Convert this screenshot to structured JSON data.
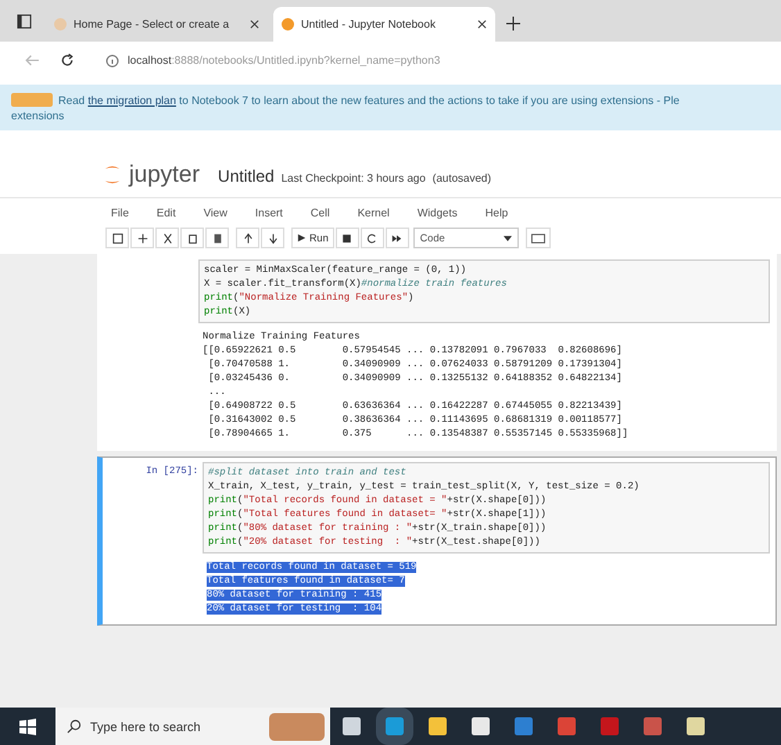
{
  "browser_tabs": [
    {
      "title": "Home Page - Select or create a",
      "selected": false
    },
    {
      "title": "Untitled - Jupyter Notebook",
      "selected": true
    }
  ],
  "address_bar": {
    "host": "localhost",
    "path": ":8888/notebooks/Untitled.ipynb?kernel_name=python3"
  },
  "banner": {
    "link": "the migration plan",
    "before": "Read",
    "after": "to Notebook 7 to learn about the new features and the actions to take if you are using extensions - Ple",
    "line_2": "extensions"
  },
  "notebook": {
    "logo": "jupyter",
    "name": "Untitled",
    "checkpoint": "Last Checkpoint: 3 hours ago",
    "autosave": "(autosaved)"
  },
  "menu": [
    "File",
    "Edit",
    "View",
    "Insert",
    "Cell",
    "Kernel",
    "Widgets",
    "Help"
  ],
  "toolbar": {
    "run": "Run",
    "cell_type": "Code"
  },
  "cells": [
    {
      "selected": false,
      "code": [
        [
          {
            "kind": "plain",
            "text": "scaler = MinMaxScaler(feature_range = (0, 1))"
          }
        ],
        [
          {
            "kind": "plain",
            "text": "X = scaler.fit_transform(X)"
          },
          {
            "kind": "comment",
            "text": "#normalize train features"
          }
        ],
        [
          {
            "kind": "builtin",
            "text": "print"
          },
          {
            "kind": "plain",
            "text": "("
          },
          {
            "kind": "string",
            "text": "\"Normalize Training Features\""
          },
          {
            "kind": "plain",
            "text": ")"
          }
        ],
        [
          {
            "kind": "builtin",
            "text": "print"
          },
          {
            "kind": "plain",
            "text": "(X)"
          }
        ]
      ],
      "output": {
        "highlighted": false,
        "lines": [
          "Normalize Training Features",
          "[[0.65922621 0.5        0.57954545 ... 0.13782091 0.7967033  0.82608696]",
          " [0.70470588 1.         0.34090909 ... 0.07624033 0.58791209 0.17391304]",
          " [0.03245436 0.         0.34090909 ... 0.13255132 0.64188352 0.64822134]",
          " ...",
          " [0.64908722 0.5        0.63636364 ... 0.16422287 0.67445055 0.82213439]",
          " [0.31643002 0.5        0.38636364 ... 0.11143695 0.68681319 0.00118577]",
          " [0.78904665 1.         0.375      ... 0.13548387 0.55357145 0.55335968]]"
        ]
      }
    },
    {
      "prompt": "In [275]:",
      "selected": true,
      "code": [
        [
          {
            "kind": "comment",
            "text": "#split dataset into train and test"
          }
        ],
        [
          {
            "kind": "plain",
            "text": "X_train, X_test, y_train, y_test = train_test_split(X, Y, test_size = 0.2)"
          }
        ],
        [
          {
            "kind": "builtin",
            "text": "print"
          },
          {
            "kind": "plain",
            "text": "("
          },
          {
            "kind": "string",
            "text": "\"Total records found in dataset = \""
          },
          {
            "kind": "plain",
            "text": "+str(X.shape[0]))"
          }
        ],
        [
          {
            "kind": "builtin",
            "text": "print"
          },
          {
            "kind": "plain",
            "text": "("
          },
          {
            "kind": "string",
            "text": "\"Total features found in dataset= \""
          },
          {
            "kind": "plain",
            "text": "+str(X.shape[1]))"
          }
        ],
        [
          {
            "kind": "builtin",
            "text": "print"
          },
          {
            "kind": "plain",
            "text": "("
          },
          {
            "kind": "string",
            "text": "\"80% dataset for training : \""
          },
          {
            "kind": "plain",
            "text": "+str(X_train.shape[0]))"
          }
        ],
        [
          {
            "kind": "builtin",
            "text": "print"
          },
          {
            "kind": "plain",
            "text": "("
          },
          {
            "kind": "string",
            "text": "\"20% dataset for testing  : \""
          },
          {
            "kind": "plain",
            "text": "+str(X_test.shape[0]))"
          }
        ]
      ],
      "output": {
        "highlighted": true,
        "lines": [
          "Total records found in dataset = 519",
          "Total features found in dataset= 7",
          "80% dataset for training : 415",
          "20% dataset for testing  : 104"
        ]
      }
    }
  ],
  "taskbar": {
    "search_placeholder": "Type here to search"
  }
}
